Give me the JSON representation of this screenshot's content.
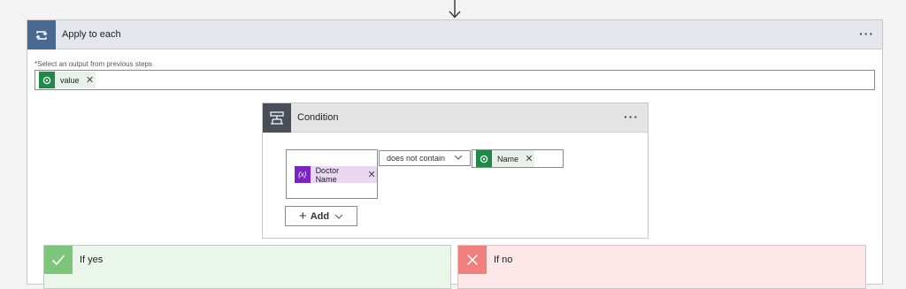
{
  "loop": {
    "title": "Apply to each",
    "more_label": "···",
    "select": {
      "required_marker": "*",
      "label": "Select an output from previous steps",
      "token": {
        "label": "value",
        "icon": "dataverse-icon"
      }
    }
  },
  "condition": {
    "title": "Condition",
    "more_label": "···",
    "left_token": {
      "label": "Doctor Name",
      "icon": "variable-icon",
      "icon_text": "{x}"
    },
    "operator": "does not contain",
    "right_token": {
      "label": "Name",
      "icon": "dataverse-icon"
    },
    "add_label": "Add"
  },
  "branches": {
    "yes_label": "If yes",
    "no_label": "If no"
  },
  "colors": {
    "loop_accent": "#486991",
    "condition_accent": "#484f58",
    "dataverse_green": "#1f8a45",
    "variable_purple": "#7a24c8",
    "yes_green": "#7cc57a",
    "no_red": "#f0807e"
  }
}
